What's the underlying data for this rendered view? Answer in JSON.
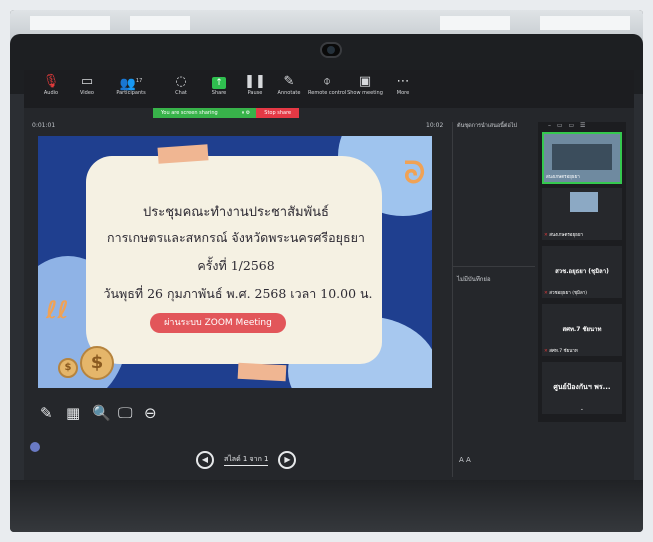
{
  "toolbar": {
    "items": [
      {
        "label": "Audio",
        "icon": "microphone-icon"
      },
      {
        "label": "Video",
        "icon": "camera-icon"
      },
      {
        "label": "Participants",
        "icon": "participants-icon",
        "badge": "17"
      },
      {
        "label": "Chat",
        "icon": "chat-icon"
      },
      {
        "label": "Share",
        "icon": "share-screen-icon"
      },
      {
        "label": "Pause",
        "icon": "pause-icon"
      },
      {
        "label": "Annotate",
        "icon": "pen-icon"
      },
      {
        "label": "Remote control",
        "icon": "mouse-icon"
      },
      {
        "label": "Show meeting",
        "icon": "window-icon"
      },
      {
        "label": "More",
        "icon": "more-icon"
      }
    ]
  },
  "share_bar": {
    "status": "You are screen sharing",
    "stop_label": "Stop share"
  },
  "timer": "0:01:01",
  "clock": "10:02",
  "slide": {
    "line1": "ประชุมคณะทำงานประชาสัมพันธ์",
    "line2": "การเกษตรและสหกรณ์ จังหวัดพระนครศรีอยุธยา",
    "line3": "ครั้งที่ 1/2568",
    "line4": "วันพุธที่ 26 กุมภาพันธ์ พ.ศ. 2568 เวลา 10.00 น.",
    "pill": "ผ่านระบบ ZOOM Meeting"
  },
  "side_panel": {
    "title": "ต้นชุดการนำเสนอนี้ต่อไป",
    "no_chat": "ไม่มีบันทึกย่อ",
    "font_controls": "A  A"
  },
  "gallery": {
    "tiles": [
      {
        "name": "สนงเกษตรอยุธยา"
      },
      {
        "name": "สนงเกษตรอยุธยา"
      },
      {
        "center": "สวช.อยุธยา (ชุมิลา)",
        "name": "สวชอยุธยา (ชุมิลา)"
      },
      {
        "center": "สศท.7 ชัยนาท",
        "name": "สศท.7 ชัยนาท"
      },
      {
        "center": "ศูนย์ป้องกันฯ พร..."
      }
    ]
  },
  "nav": {
    "page_label": "สไลด์ 1 จาก 1"
  },
  "colors": {
    "slide_bg": "#1f3f8f",
    "card": "#f5f1e3",
    "pill": "#e2565a",
    "share_green": "#38b34a",
    "stop_red": "#e53945"
  }
}
